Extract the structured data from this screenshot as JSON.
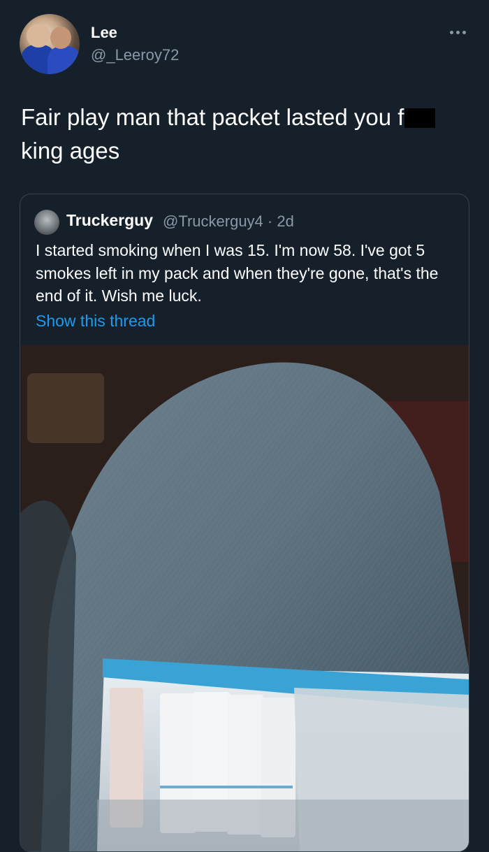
{
  "user": {
    "name": "Lee",
    "handle": "@_Leeroy72"
  },
  "tweet": {
    "text_part1": "Fair play man that packet lasted you f",
    "text_part2": "king ages"
  },
  "quoted_tweet": {
    "name": "Truckerguy",
    "handle_time": "@Truckerguy4 · 2d",
    "text": "I started smoking when I was 15. I'm now 58. I've got 5 smokes left in my pack and when they're gone, that's the end of it. Wish me luck.",
    "link_label": "Show this thread"
  },
  "icons": {
    "more": "more-horizontal-icon"
  },
  "colors": {
    "background": "#15202b",
    "secondary_text": "#8b98a5",
    "link": "#1d9bf0",
    "border": "#38444d"
  }
}
